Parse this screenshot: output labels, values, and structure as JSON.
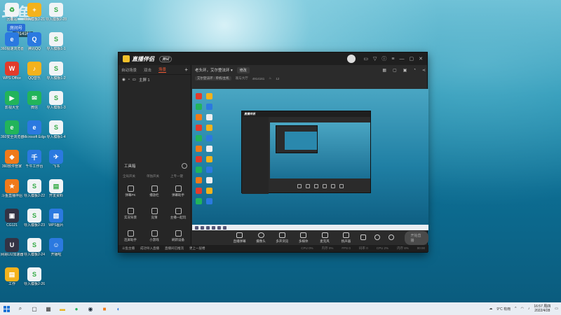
{
  "watermark": "斗鱼",
  "room": {
    "label": "房间号",
    "number": "4914161"
  },
  "desktop_icons": [
    {
      "label": "回收站",
      "color": "wh",
      "glyph": "♻"
    },
    {
      "label": "360极速浏览器",
      "color": "b",
      "glyph": "e"
    },
    {
      "label": "WPS Office",
      "color": "w",
      "glyph": "W"
    },
    {
      "label": "影视大全",
      "color": "g",
      "glyph": "▶"
    },
    {
      "label": "360安全浏览器",
      "color": "g",
      "glyph": "e"
    },
    {
      "label": "360软件管家",
      "color": "o",
      "glyph": "◆"
    },
    {
      "label": "斗鱼直播伴侣",
      "color": "o",
      "glyph": "★"
    },
    {
      "label": "CG121",
      "color": "dk",
      "glyph": "▣"
    },
    {
      "label": "网易UU加速器",
      "color": "dk",
      "glyph": "U"
    },
    {
      "label": "工作",
      "color": "y",
      "glyph": "▤"
    }
  ],
  "desktop_icons_col2": [
    {
      "label": "导入模板2-21",
      "color": "y",
      "glyph": "+"
    },
    {
      "label": "腾讯QQ",
      "color": "b",
      "glyph": "Q"
    },
    {
      "label": "QQ音乐",
      "color": "y",
      "glyph": "♪"
    },
    {
      "label": "微信",
      "color": "g",
      "glyph": "✉"
    },
    {
      "label": "Microsoft Edge",
      "color": "b",
      "glyph": "e"
    },
    {
      "label": "千牛工作台",
      "color": "b",
      "glyph": "千"
    },
    {
      "label": "导入模板2-22",
      "color": "wh",
      "glyph": "S"
    },
    {
      "label": "导入模板2-23",
      "color": "wh",
      "glyph": "S"
    },
    {
      "label": "导入模板2-24",
      "color": "wh",
      "glyph": "S"
    },
    {
      "label": "导入模板2-26",
      "color": "wh",
      "glyph": "S"
    }
  ],
  "desktop_icons_col3": [
    {
      "label": "导入模板2-28",
      "color": "wh",
      "glyph": "S"
    },
    {
      "label": "导入模板1-1",
      "color": "wh",
      "glyph": "S"
    },
    {
      "label": "导入模板1-2",
      "color": "wh",
      "glyph": "S"
    },
    {
      "label": "导入模板1-3",
      "color": "wh",
      "glyph": "S"
    },
    {
      "label": "导入模板1-4",
      "color": "wh",
      "glyph": "S"
    },
    {
      "label": "飞书",
      "color": "b",
      "glyph": "✈"
    },
    {
      "label": "开发资料",
      "color": "wh",
      "glyph": "▤"
    },
    {
      "label": "WPS图片",
      "color": "b",
      "glyph": "▧"
    },
    {
      "label": "开播啦",
      "color": "b",
      "glyph": "☺"
    }
  ],
  "app": {
    "title": "直播伴侣",
    "version": "测试",
    "left_tabs": [
      "自动场景",
      "双击",
      "场景"
    ],
    "active_tab": "场景",
    "scene_name": "主屏 1",
    "tools_title": "工具箱",
    "tool_subs": [
      "全局开关",
      "单独开关",
      "上专一键"
    ],
    "tools": [
      {
        "label": "弹幕PK"
      },
      {
        "label": "播放栏"
      },
      {
        "label": "弹幕助手"
      },
      {
        "label": "实况背景"
      },
      {
        "label": "竞猜"
      },
      {
        "label": "主播一起玩"
      },
      {
        "label": "连屏助手"
      },
      {
        "label": "小游戏"
      },
      {
        "label": "刷新设备"
      }
    ],
    "room_title": "老头环，艾尔登法环 ▾",
    "edit_label": "修改",
    "category": "艾尔登法环 · 单机/主机",
    "anchor": "观与大厅",
    "room_id": "4914161",
    "fans": "12",
    "controls": [
      {
        "label": "直播弹幕"
      },
      {
        "label": "摄像头"
      },
      {
        "label": "多开浏览"
      },
      {
        "label": "多媒体"
      },
      {
        "label": "麦克风"
      },
      {
        "label": "扬声器"
      }
    ],
    "live_button": "开始直播",
    "status_text": [
      "斗鱼主播",
      "成功导入直播",
      "直播间已推流",
      "更上一层楼"
    ],
    "stats": [
      "CPU 0%",
      "内存 0%",
      "FPS 0",
      "码率 0",
      "CPU 2%",
      "内存 8%",
      "00:00"
    ]
  },
  "taskbar": {
    "weather": "9°C 有雨",
    "time": "16:57 周四",
    "date": "2022/4/28"
  }
}
